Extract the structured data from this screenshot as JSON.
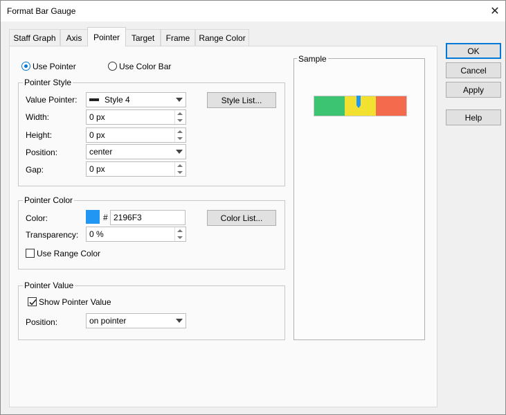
{
  "window": {
    "title": "Format Bar Gauge"
  },
  "tabs": [
    {
      "label": "Staff Graph"
    },
    {
      "label": "Axis"
    },
    {
      "label": "Pointer"
    },
    {
      "label": "Target"
    },
    {
      "label": "Frame"
    },
    {
      "label": "Range Color"
    }
  ],
  "active_tab": "Pointer",
  "mode": {
    "use_pointer_label": "Use Pointer",
    "use_pointer_selected": true,
    "use_color_bar_label": "Use Color Bar",
    "use_color_bar_selected": false
  },
  "pointer_style": {
    "group_title": "Pointer Style",
    "value_pointer_label": "Value Pointer:",
    "value_pointer_value": "Style 4",
    "style_list_button": "Style List...",
    "width_label": "Width:",
    "width_value": "0 px",
    "height_label": "Height:",
    "height_value": "0 px",
    "position_label": "Position:",
    "position_value": "center",
    "gap_label": "Gap:",
    "gap_value": "0 px"
  },
  "pointer_color": {
    "group_title": "Pointer Color",
    "color_label": "Color:",
    "hash": "#",
    "color_hex": "2196F3",
    "swatch_color": "#2196F3",
    "color_list_button": "Color List...",
    "transparency_label": "Transparency:",
    "transparency_value": "0 %",
    "use_range_color_label": "Use Range Color",
    "use_range_color_checked": false
  },
  "pointer_value": {
    "group_title": "Pointer Value",
    "show_label": "Show Pointer Value",
    "show_checked": true,
    "position_label": "Position:",
    "position_value": "on pointer"
  },
  "sample": {
    "title": "Sample",
    "bar_colors": [
      "#3DC473",
      "#F2E131",
      "#F46A4C"
    ],
    "pointer_color": "#2196F3"
  },
  "buttons": {
    "ok": "OK",
    "cancel": "Cancel",
    "apply": "Apply",
    "help": "Help"
  }
}
